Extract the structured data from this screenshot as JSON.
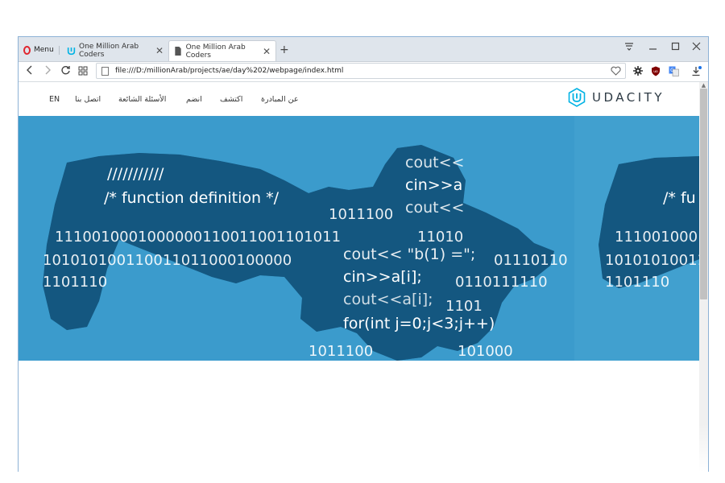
{
  "browser": {
    "menu_label": "Menu",
    "tabs": [
      {
        "title": "One Million Arab Coders",
        "active": false,
        "icon": "udacity-icon"
      },
      {
        "title": "One Million Arab Coders",
        "active": true,
        "icon": "page-icon"
      }
    ],
    "url": "file:///D:/millionArab/projects/ae/day%202/webpage/index.html",
    "accent_color": "#e0262f"
  },
  "site": {
    "nav_links": [
      "EN",
      "اتصل بنا",
      "الأسئلة الشائعة",
      "انضم",
      "اكتشف",
      "عن المبادرة"
    ],
    "logo_text": "UDACITY",
    "brand_color": "#02b3e4"
  },
  "hero": {
    "code_lines": [
      "///////////",
      "/*  function definition   */",
      "cout<<",
      "cin>>a",
      "cout<<",
      "cout<<  \"b(1) =\";",
      "cin>>a[i];",
      "cout<<a[i];",
      "for(int j=0;j<3;j++)",
      "/*  fu"
    ],
    "binary_lines": [
      "1110010001000000110011001101011",
      "101010100110011011000100000",
      "1101110",
      "1011100",
      "11010",
      "01110110",
      "0110111110",
      "1101",
      "1011100",
      "101000"
    ]
  }
}
